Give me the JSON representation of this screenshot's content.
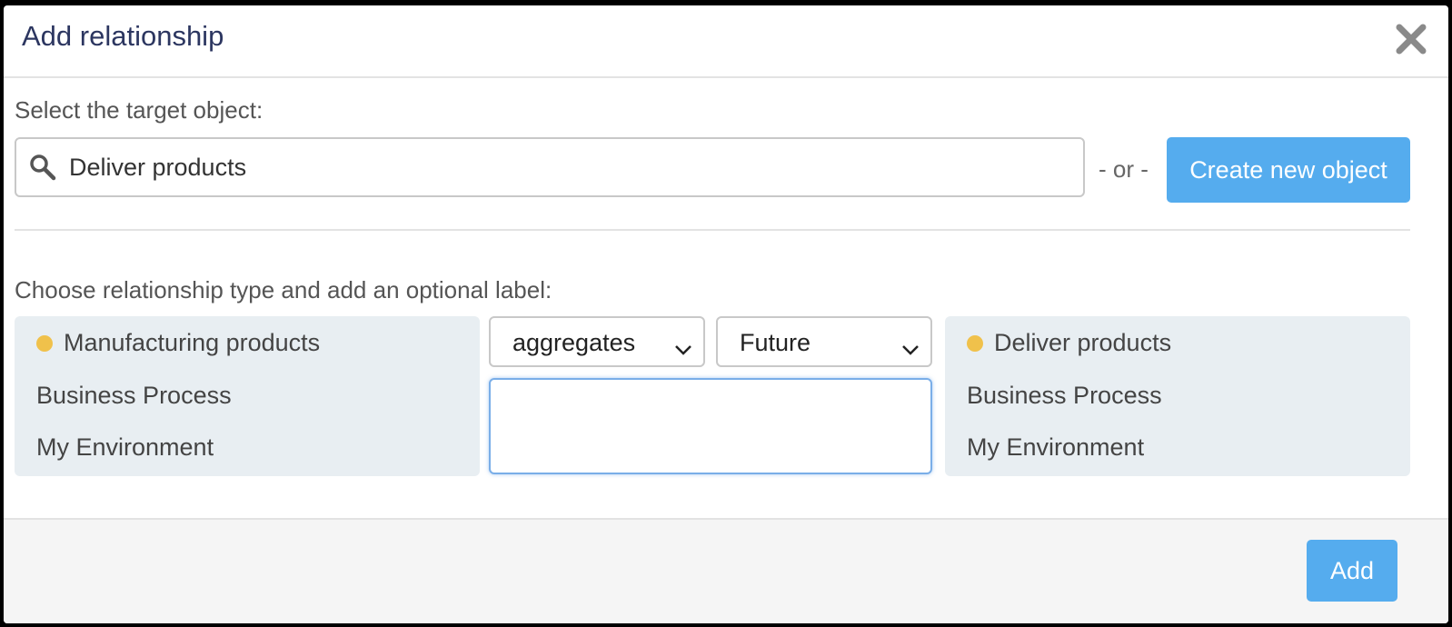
{
  "dialog": {
    "title": "Add relationship",
    "close_icon": "close-icon"
  },
  "target": {
    "label": "Select the target object:",
    "search_value": "Deliver products",
    "search_icon": "search-icon",
    "or_text": "- or -",
    "create_button": "Create new object"
  },
  "relationship": {
    "label": "Choose relationship type and add an optional label:",
    "source": {
      "name": "Manufacturing products",
      "type": "Business Process",
      "environment": "My Environment"
    },
    "type_select": "aggregates",
    "time_select": "Future",
    "label_value": "",
    "target": {
      "name": "Deliver products",
      "type": "Business Process",
      "environment": "My Environment"
    }
  },
  "footer": {
    "add_button": "Add"
  },
  "colors": {
    "accent": "#55acee",
    "dot": "#f0c14b",
    "card_bg": "#e8eef2",
    "title": "#2c3660"
  }
}
